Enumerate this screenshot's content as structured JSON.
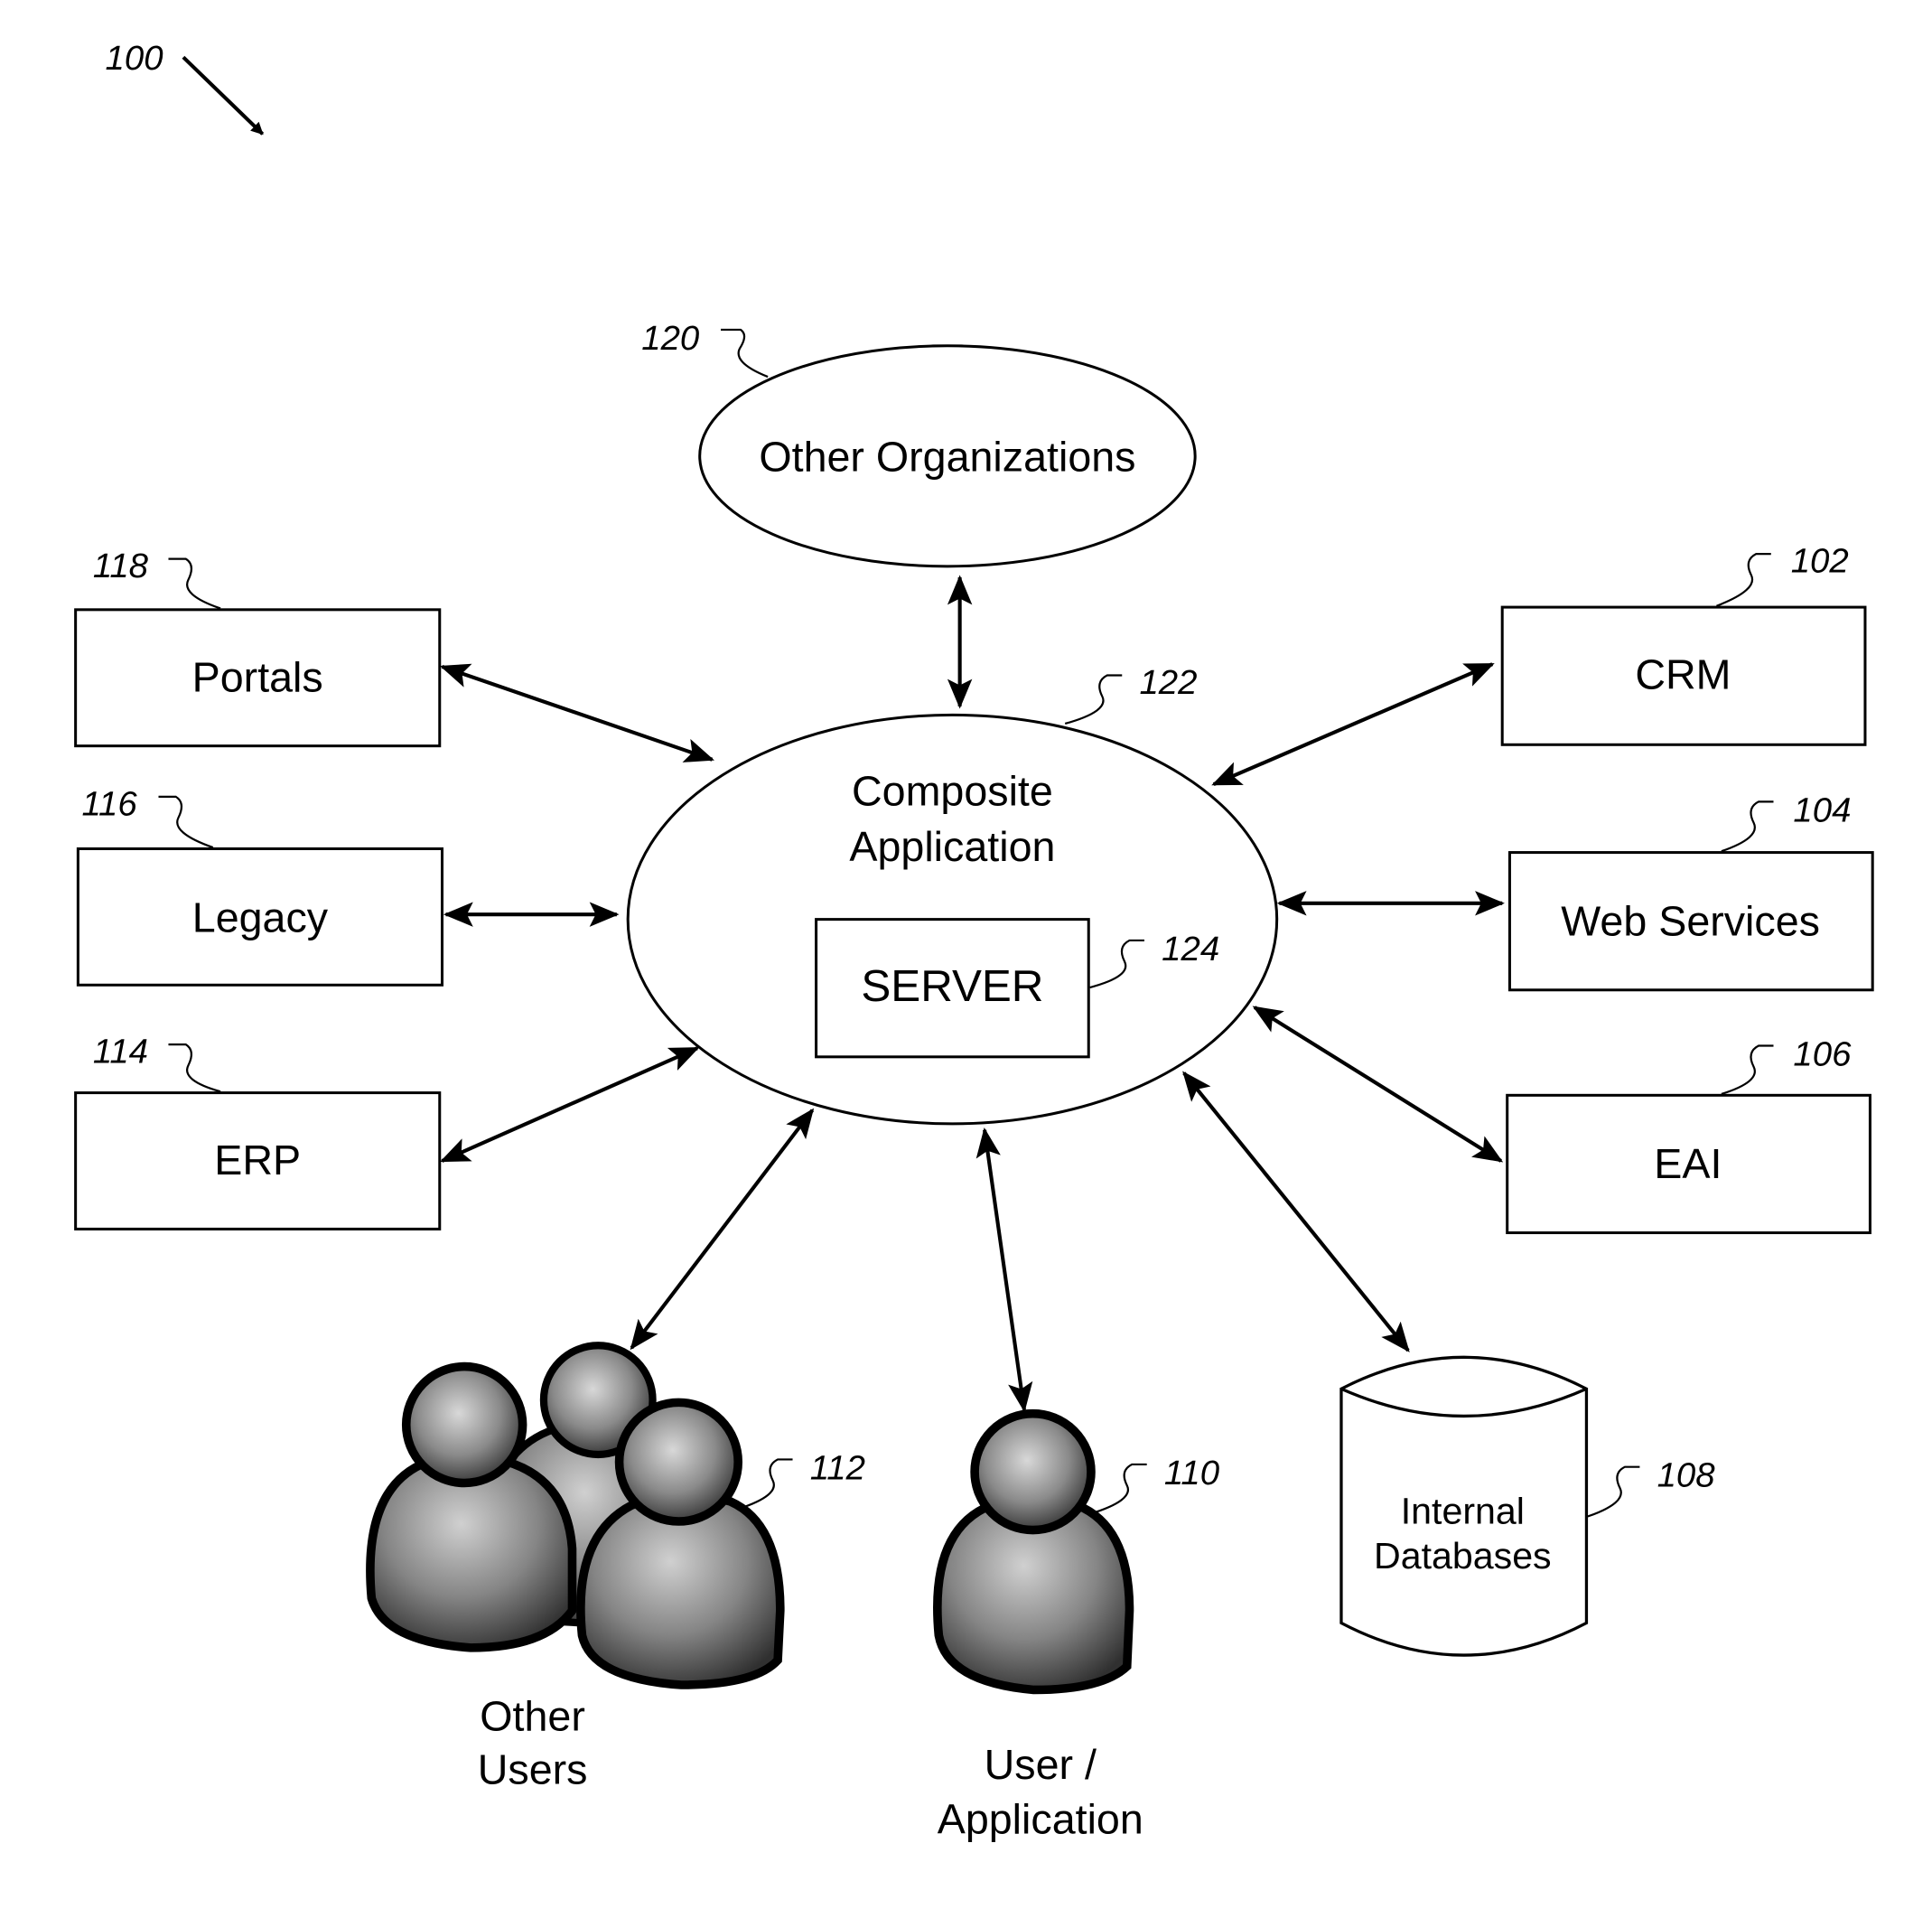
{
  "figure_ref": "100",
  "center": {
    "ref": "122",
    "title_line1": "Composite",
    "title_line2": "Application",
    "server": {
      "ref": "124",
      "label": "SERVER"
    }
  },
  "top": {
    "ref": "120",
    "label": "Other Organizations"
  },
  "left_boxes": [
    {
      "ref": "118",
      "label": "Portals"
    },
    {
      "ref": "116",
      "label": "Legacy"
    },
    {
      "ref": "114",
      "label": "ERP"
    }
  ],
  "right_boxes": [
    {
      "ref": "102",
      "label": "CRM"
    },
    {
      "ref": "104",
      "label": "Web Services"
    },
    {
      "ref": "106",
      "label": "EAI"
    }
  ],
  "bottom": {
    "other_users": {
      "ref": "112",
      "line1": "Other",
      "line2": "Users"
    },
    "user_app": {
      "ref": "110",
      "line1": "User /",
      "line2": "Application"
    },
    "database": {
      "ref": "108",
      "line1": "Internal",
      "line2": "Databases"
    }
  },
  "colors": {
    "stroke": "#000000",
    "background": "#ffffff",
    "figure_gray": "#8a8a8a"
  }
}
